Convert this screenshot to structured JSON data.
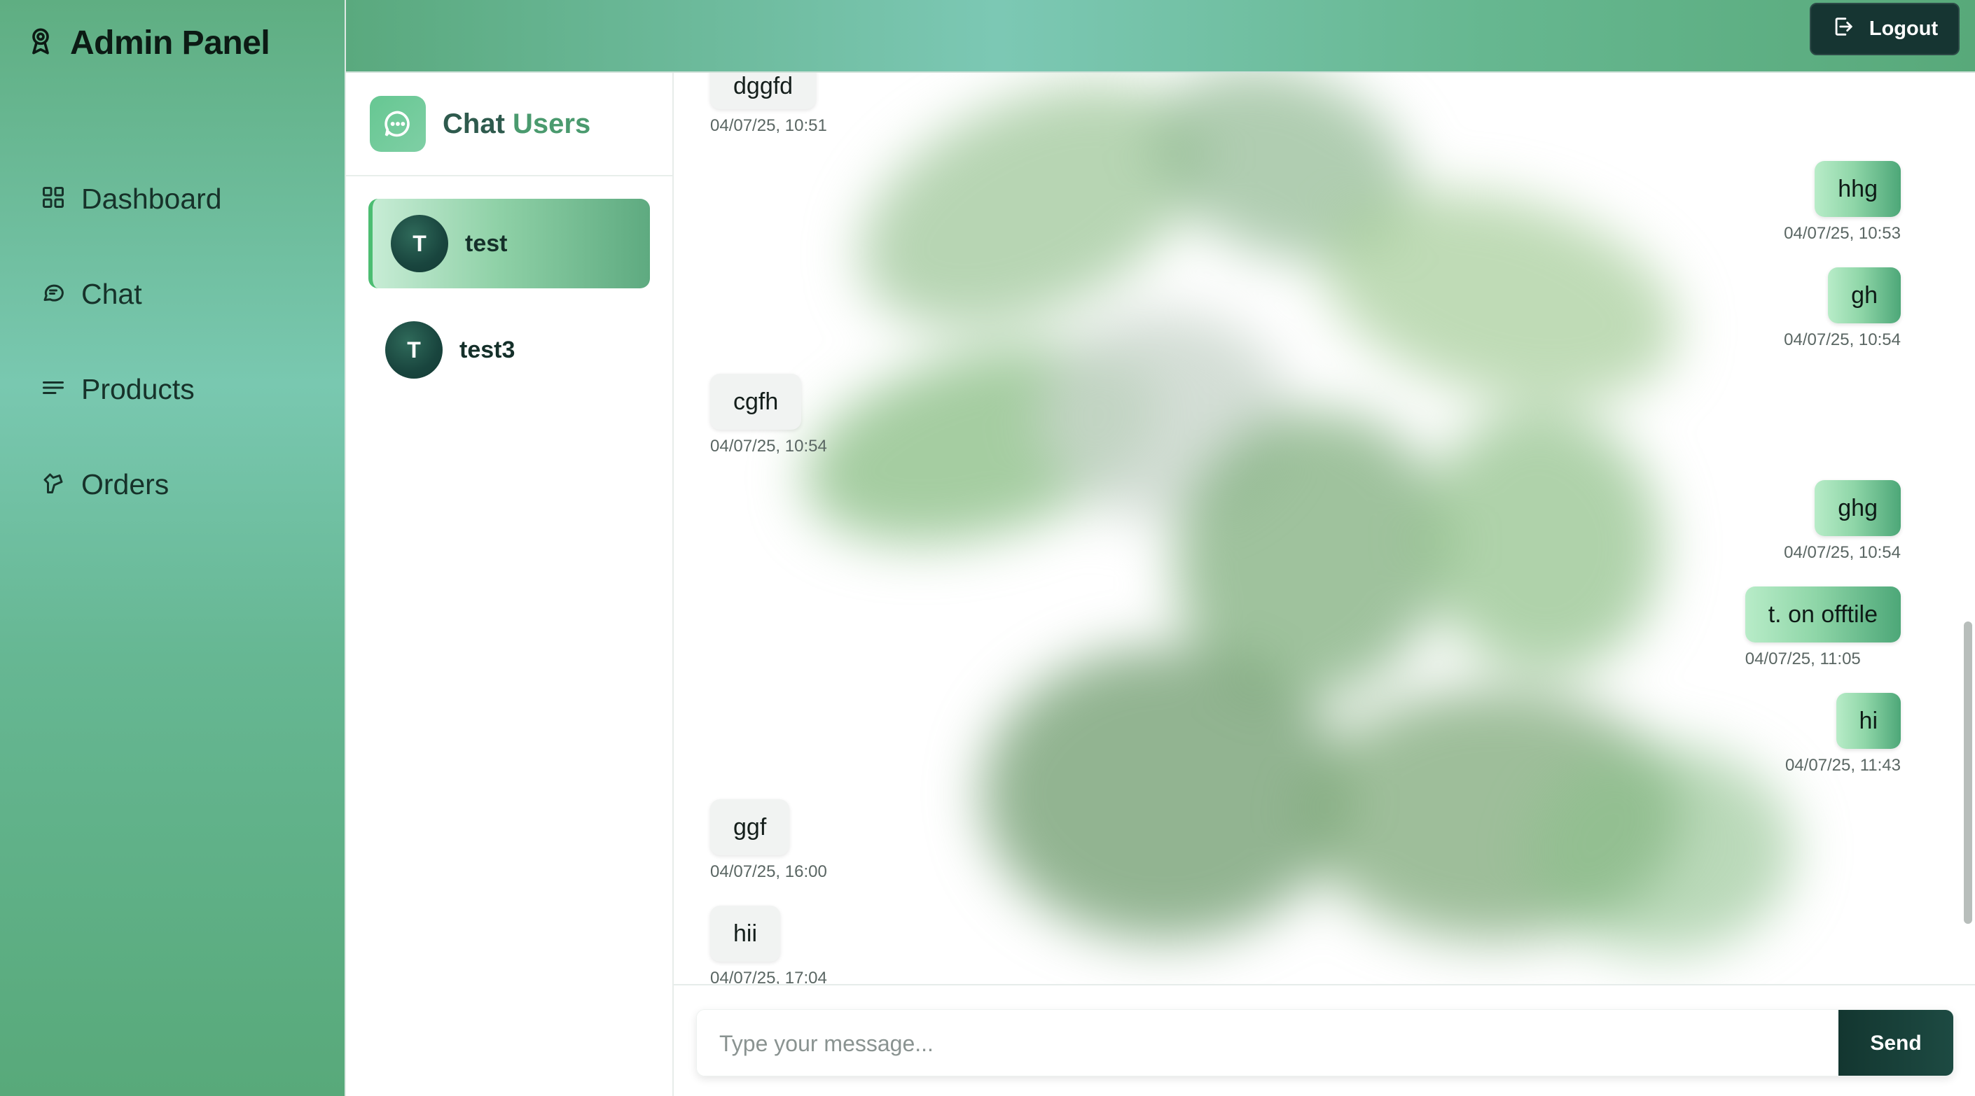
{
  "sidebar": {
    "brand_icon": "award-icon",
    "brand_title": "Admin Panel",
    "items": [
      {
        "label": "Dashboard",
        "icon": "grid-icon"
      },
      {
        "label": "Chat",
        "icon": "message-icon"
      },
      {
        "label": "Products",
        "icon": "list-icon"
      },
      {
        "label": "Orders",
        "icon": "cart-icon"
      }
    ]
  },
  "topbar": {
    "logout_label": "Logout",
    "logout_icon": "logout-icon"
  },
  "users_panel": {
    "title_part1": "Chat",
    "title_part2": "Users",
    "header_icon": "chat-bubble-icon",
    "users": [
      {
        "initial": "T",
        "name": "test",
        "active": true
      },
      {
        "initial": "T",
        "name": "test3",
        "active": false
      }
    ]
  },
  "messages": [
    {
      "text": "dggfd",
      "time": "04/07/25, 10:51",
      "side": "in"
    },
    {
      "text": "hhg",
      "time": "04/07/25, 10:53",
      "side": "out"
    },
    {
      "text": "gh",
      "time": "04/07/25, 10:54",
      "side": "out"
    },
    {
      "text": "cgfh",
      "time": "04/07/25, 10:54",
      "side": "in"
    },
    {
      "text": "ghg",
      "time": "04/07/25, 10:54",
      "side": "out"
    },
    {
      "text": "t. on offtile",
      "time": "04/07/25, 11:05",
      "side": "out"
    },
    {
      "text": "hi",
      "time": "04/07/25, 11:43",
      "side": "out"
    },
    {
      "text": "ggf",
      "time": "04/07/25, 16:00",
      "side": "in"
    },
    {
      "text": "hii",
      "time": "04/07/25, 17:04",
      "side": "in"
    }
  ],
  "composer": {
    "placeholder": "Type your message...",
    "value": "",
    "send_label": "Send"
  },
  "colors": {
    "sidebar_green": "#6cbf97",
    "accent_dark": "#163532",
    "bubble_out_end": "#4da778",
    "bubble_in": "#f1f3f2"
  }
}
